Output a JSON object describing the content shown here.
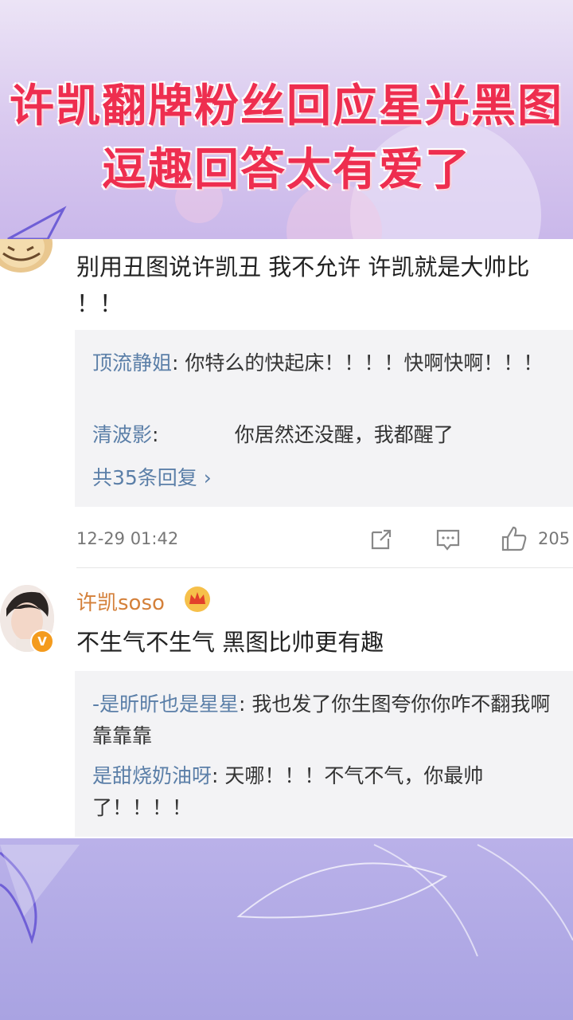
{
  "headline": {
    "line1": "许凯翻牌粉丝回应星光黑图",
    "line2": "逗趣回答太有爱了"
  },
  "post1": {
    "text": "别用丑图说许凯丑 我不允许 许凯就是大帅比 ！！",
    "replies": [
      {
        "user": "顶流静姐",
        "text": ": 你特么的快起床！！！！快啊快啊！！！"
      },
      {
        "user": "清波影",
        "text": ":            你居然还没醒，我都醒了"
      }
    ],
    "more_replies": "共35条回复 ›",
    "timestamp": "12-29 01:42",
    "likes": "205"
  },
  "post2": {
    "user": "许凯soso",
    "badge": "V",
    "text": "不生气不生气 黑图比帅更有趣",
    "replies": [
      {
        "user": "-是昕昕也是星星",
        "text": ": 我也发了你生图夸你你咋不翻我啊靠靠靠"
      },
      {
        "user": "是甜烧奶油呀",
        "text": ": 天哪！！！不气不气，你最帅了！！！！"
      }
    ]
  },
  "icons": {
    "share": "share-icon",
    "comment": "comment-icon",
    "like": "thumbs-up-icon",
    "crown": "crown-icon",
    "verified": "verified-badge-icon"
  },
  "colors": {
    "title_red": "#ee2e4f",
    "username_blue": "#5b7fa8",
    "vip_orange": "#d4803a"
  }
}
